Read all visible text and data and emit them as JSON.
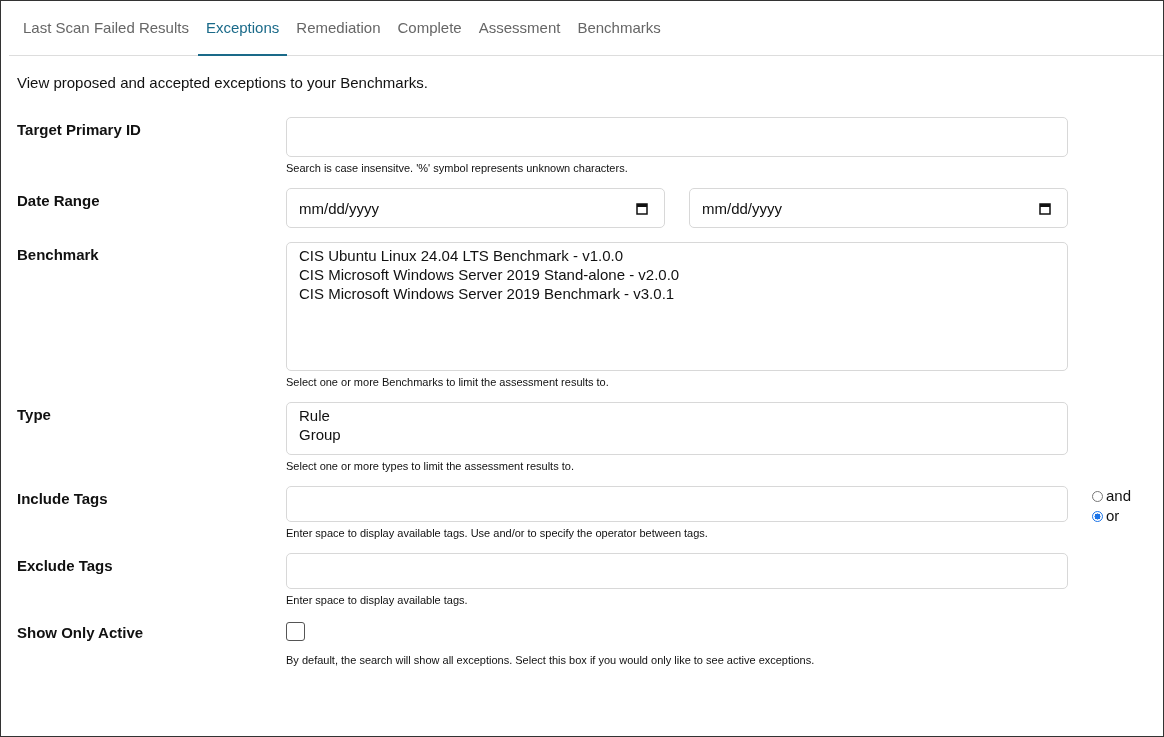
{
  "tabs": [
    {
      "label": "Last Scan Failed Results",
      "selected": false
    },
    {
      "label": "Exceptions",
      "selected": true
    },
    {
      "label": "Remediation",
      "selected": false
    },
    {
      "label": "Complete",
      "selected": false
    },
    {
      "label": "Assessment",
      "selected": false
    },
    {
      "label": "Benchmarks",
      "selected": false
    }
  ],
  "intro": "View proposed and accepted exceptions to your Benchmarks.",
  "fields": [
    {
      "kind": "text",
      "label": "Target Primary ID",
      "help": "Search is case insensitve. '%' symbol represents unknown characters."
    },
    {
      "kind": "daterange",
      "label": "Date Range",
      "inputs": [
        {
          "placeholder": "mm/dd/yyyy"
        },
        {
          "placeholder": "mm/dd/yyyy"
        }
      ]
    },
    {
      "kind": "listbox",
      "label": "Benchmark",
      "options": [
        "CIS Ubuntu Linux 24.04 LTS Benchmark - v1.0.0",
        "CIS Microsoft Windows Server 2019 Stand-alone - v2.0.0",
        "CIS Microsoft Windows Server 2019 Benchmark - v3.0.1"
      ],
      "help": "Select one or more Benchmarks to limit the assessment results to."
    },
    {
      "kind": "listbox",
      "label": "Type",
      "options": [
        "Rule",
        "Group"
      ],
      "help": "Select one or more types to limit the assessment results to."
    },
    {
      "kind": "tags",
      "label": "Include Tags",
      "help": "Enter space to display available tags. Use and/or to specify the operator between tags.",
      "operators": [
        {
          "label": "and",
          "selected": false
        },
        {
          "label": "or",
          "selected": true
        }
      ]
    },
    {
      "kind": "tags",
      "label": "Exclude Tags",
      "help": "Enter space to display available tags."
    },
    {
      "kind": "checkbox",
      "label": "Show Only Active",
      "checked": false,
      "help": "By default, the search will show all exceptions. Select this box if you would only like to see active exceptions."
    }
  ]
}
